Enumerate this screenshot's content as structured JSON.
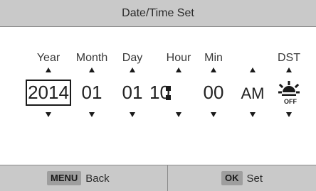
{
  "title": "Date/Time Set",
  "fields": {
    "year": {
      "label": "Year",
      "value": "2014"
    },
    "month": {
      "label": "Month",
      "value": "01"
    },
    "day": {
      "label": "Day",
      "value": "01"
    },
    "hour": {
      "label": "Hour",
      "value": "10"
    },
    "min": {
      "label": "Min",
      "value": "00"
    },
    "ampm": {
      "label": "",
      "value": "AM"
    },
    "dst": {
      "label": "DST",
      "icon": "sun-off-icon",
      "icon_text": "OFF"
    }
  },
  "footer": {
    "menu_key": "MENU",
    "menu_label": "Back",
    "ok_key": "OK",
    "ok_label": "Set"
  }
}
